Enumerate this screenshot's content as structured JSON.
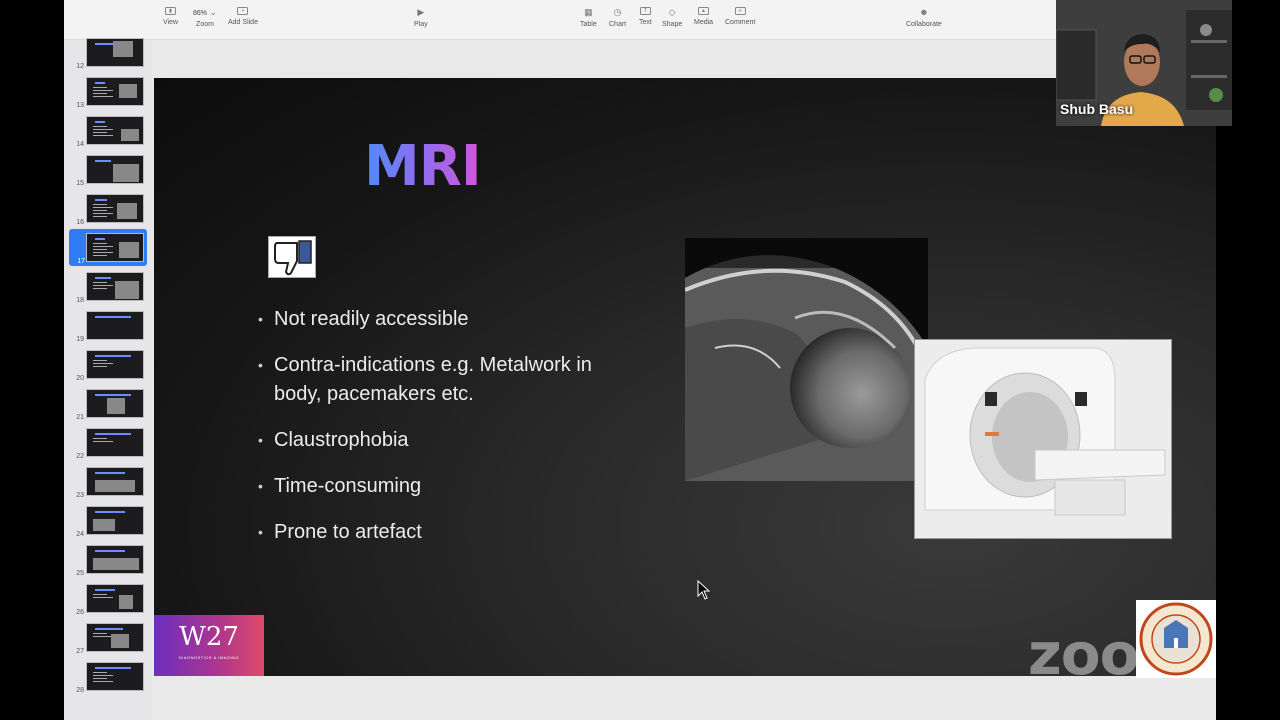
{
  "toolbar": {
    "view_label": "View",
    "zoom_value": "86%",
    "zoom_label": "Zoom",
    "add_slide_label": "Add Slide",
    "play_label": "Play",
    "table_label": "Table",
    "chart_label": "Chart",
    "text_label": "Text",
    "shape_label": "Shape",
    "media_label": "Media",
    "comment_label": "Comment",
    "collaborate_label": "Collaborate"
  },
  "sidebar": {
    "slides": [
      {
        "number": "12",
        "selected": false
      },
      {
        "number": "13",
        "selected": false
      },
      {
        "number": "14",
        "selected": false
      },
      {
        "number": "15",
        "selected": false
      },
      {
        "number": "16",
        "selected": false
      },
      {
        "number": "17",
        "selected": true
      },
      {
        "number": "18",
        "selected": false
      },
      {
        "number": "19",
        "selected": false
      },
      {
        "number": "20",
        "selected": false
      },
      {
        "number": "21",
        "selected": false
      },
      {
        "number": "22",
        "selected": false
      },
      {
        "number": "23",
        "selected": false
      },
      {
        "number": "24",
        "selected": false
      },
      {
        "number": "25",
        "selected": false
      },
      {
        "number": "26",
        "selected": false
      },
      {
        "number": "27",
        "selected": false
      },
      {
        "number": "28",
        "selected": false
      }
    ]
  },
  "slide": {
    "title": "MRI",
    "bullets": [
      "Not readily accessible",
      "Contra-indications e.g. Metalwork in body, pacemakers etc.",
      "Claustrophobia",
      "Time-consuming",
      "Prone to artefact"
    ],
    "logo_text": "W27",
    "logo_subtext": "DIAGNOSTICS & IMAGING"
  },
  "webcam": {
    "participant_name": "Shub Basu"
  },
  "overlay": {
    "zoom_watermark": "zoom"
  },
  "colors": {
    "title_gradient_start": "#4f8df7",
    "title_gradient_end": "#d456d8",
    "selection_blue": "#2f7cf6"
  }
}
